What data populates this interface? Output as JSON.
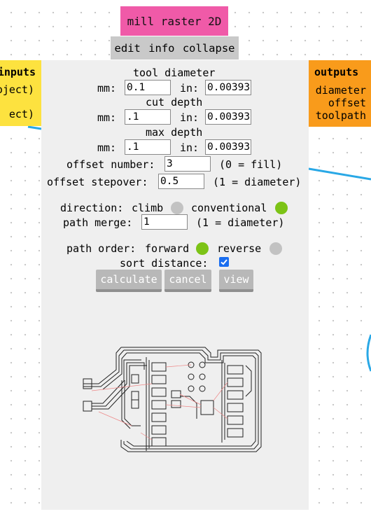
{
  "module": {
    "title": "mill raster 2D",
    "menu": [
      "edit",
      "info",
      "collapse"
    ]
  },
  "inputs": {
    "title": "inputs",
    "items": [
      "oject)",
      "ect)"
    ]
  },
  "outputs": {
    "title": "outputs",
    "items": [
      "diameter",
      "offset",
      "toolpath"
    ]
  },
  "form": {
    "tool_diameter": {
      "label": "tool diameter",
      "mm_label": "mm:",
      "mm_value": "0.1",
      "in_label": "in:",
      "in_value": "0.00393"
    },
    "cut_depth": {
      "label": "cut depth",
      "mm_label": "mm:",
      "mm_value": ".1",
      "in_label": "in:",
      "in_value": "0.00393"
    },
    "max_depth": {
      "label": "max depth",
      "mm_label": "mm:",
      "mm_value": ".1",
      "in_label": "in:",
      "in_value": "0.00393"
    },
    "offset_number": {
      "label": "offset number:",
      "value": "3",
      "hint": "(0 = fill)"
    },
    "offset_stepover": {
      "label": "offset stepover:",
      "value": "0.5",
      "hint": "(1 = diameter)"
    },
    "direction": {
      "label": "direction:",
      "option_a": "climb",
      "option_b": "conventional",
      "selected": "conventional"
    },
    "path_merge": {
      "label": "path merge:",
      "value": "1",
      "hint": "(1 = diameter)"
    },
    "path_order": {
      "label": "path order:",
      "option_a": "forward",
      "option_b": "reverse",
      "selected": "forward"
    },
    "sort_distance": {
      "label": "sort distance:",
      "checked": true
    }
  },
  "buttons": {
    "calculate": "calculate",
    "cancel": "cancel",
    "view": "view"
  },
  "colors": {
    "title_bg": "#f05aa8",
    "inputs_bg": "#fde23f",
    "outputs_bg": "#f99b1b",
    "panel_bg": "#efefef",
    "selected_radio": "#7cc316",
    "link_line": "#29a8e6"
  }
}
